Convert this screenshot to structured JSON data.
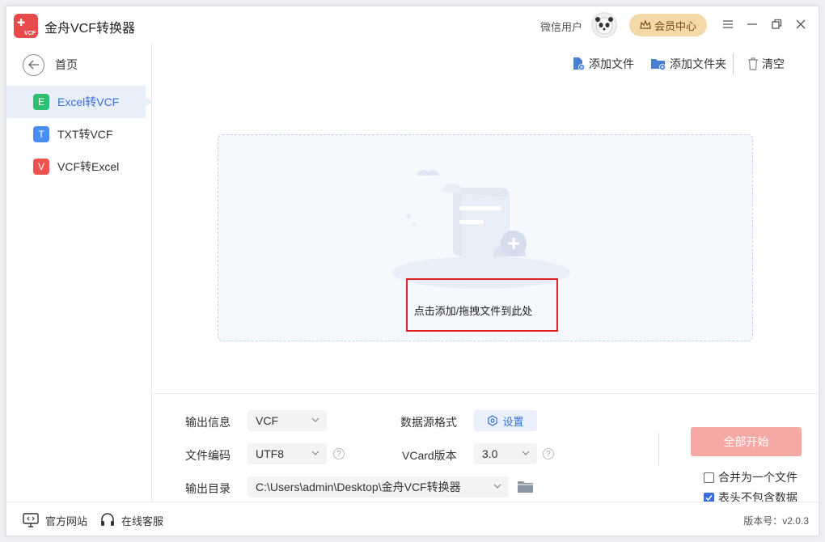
{
  "app": {
    "title": "金舟VCF转换器",
    "logo_text": "VCF",
    "user_name": "微信用户",
    "vip_label": "会员中心"
  },
  "colors": {
    "accent": "#3a6fd8",
    "start_button": "#f4a9a4",
    "vip": "#f3d8a8",
    "highlight_box": "#e02020"
  },
  "sidebar": {
    "home_label": "首页",
    "items": [
      {
        "icon_letter": "E",
        "label": "Excel转VCF",
        "icon_color": "#2fbf71",
        "active": true
      },
      {
        "icon_letter": "T",
        "label": "TXT转VCF",
        "icon_color": "#4a8df0",
        "active": false
      },
      {
        "icon_letter": "V",
        "label": "VCF转Excel",
        "icon_color": "#ef5350",
        "active": false
      }
    ]
  },
  "toolbar": {
    "add_file": "添加文件",
    "add_folder": "添加文件夹",
    "clear": "清空"
  },
  "dropzone": {
    "text": "点击添加/拖拽文件到此处"
  },
  "settings": {
    "output_info_label": "输出信息",
    "output_info_value": "VCF",
    "encoding_label": "文件编码",
    "encoding_value": "UTF8",
    "output_dir_label": "输出目录",
    "output_dir_value": "C:\\Users\\admin\\Desktop\\金舟VCF转换器",
    "source_format_label": "数据源格式",
    "settings_button": "设置",
    "vcard_version_label": "VCard版本",
    "vcard_version_value": "3.0",
    "help_glyph": "?"
  },
  "actions": {
    "start_all": "全部开始",
    "merge_label": "合并为一个文件",
    "merge_checked": false,
    "header_label": "表头不包含数据",
    "header_checked": true
  },
  "footer": {
    "website": "官方网站",
    "support": "在线客服",
    "version": "版本号：v2.0.3"
  }
}
